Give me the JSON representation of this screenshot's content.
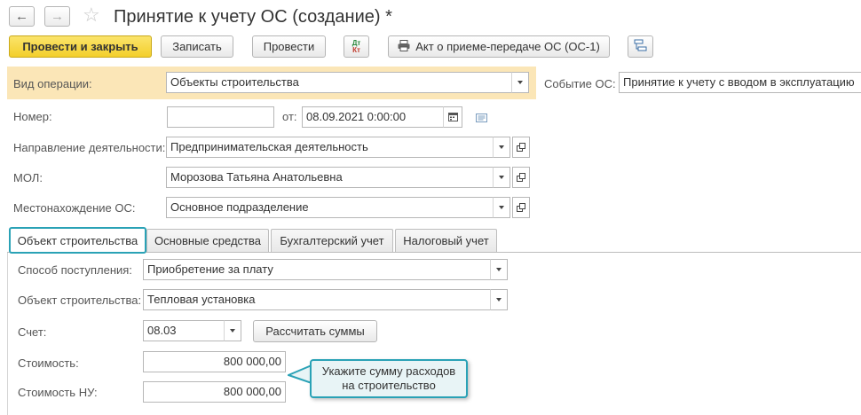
{
  "header": {
    "title": "Принятие к учету ОС (создание) *"
  },
  "toolbar": {
    "post_close": "Провести и закрыть",
    "save": "Записать",
    "post": "Провести",
    "dt_kt": "Дт\nКт",
    "act_button": "Акт о приеме-передаче ОС (ОС-1)"
  },
  "form": {
    "operation_label": "Вид операции:",
    "operation_value": "Объекты строительства",
    "event_label": "Событие ОС:",
    "event_value": "Принятие к учету с вводом в эксплуатацию",
    "number_label": "Номер:",
    "number_value": "",
    "date_label": "от:",
    "date_value": "08.09.2021  0:00:00",
    "direction_label": "Направление деятельности:",
    "direction_value": "Предпринимательская деятельность",
    "mol_label": "МОЛ:",
    "mol_value": "Морозова Татьяна Анатольевна",
    "location_label": "Местонахождение ОС:",
    "location_value": "Основное подразделение"
  },
  "tabs": [
    {
      "label": "Объект строительства",
      "active": true
    },
    {
      "label": "Основные средства",
      "active": false
    },
    {
      "label": "Бухгалтерский учет",
      "active": false
    },
    {
      "label": "Налоговый учет",
      "active": false
    }
  ],
  "panel": {
    "receipt_label": "Способ поступления:",
    "receipt_value": "Приобретение за плату",
    "object_label": "Объект строительства:",
    "object_value": "Тепловая установка",
    "account_label": "Счет:",
    "account_value": "08.03",
    "calc_button": "Рассчитать суммы",
    "cost_label": "Стоимость:",
    "cost_value": "800 000,00",
    "cost_nu_label": "Стоимость НУ:",
    "cost_nu_value": "800 000,00"
  },
  "callout": {
    "line1": "Укажите сумму расходов",
    "line2": "на строительство"
  },
  "colors": {
    "primary_button": "#f3cf2b",
    "operation_band": "#fbe6b7",
    "accent": "#2aa2b6"
  }
}
